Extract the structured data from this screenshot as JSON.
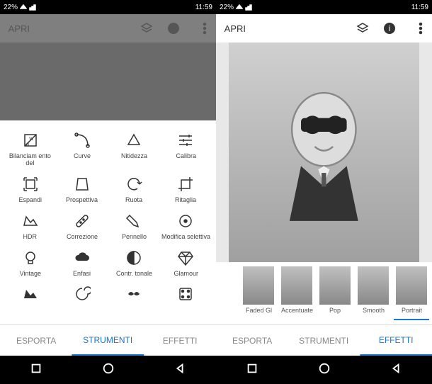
{
  "status": {
    "time": "11:59",
    "battery": "22%"
  },
  "header": {
    "open": "APRI"
  },
  "filters": [
    {
      "label": "Portrait"
    },
    {
      "label": "Smooth"
    },
    {
      "label": "Pop"
    },
    {
      "label": "Accentuate"
    },
    {
      "label": "Faded Gl"
    }
  ],
  "tabs": {
    "effects": "EFFETTI",
    "tools": "STRUMENTI",
    "export": "ESPORTA"
  },
  "tools": [
    {
      "label": "Calibra"
    },
    {
      "label": "Nitidezza"
    },
    {
      "label": "Curve"
    },
    {
      "label": "Bilanciam\nento del"
    },
    {
      "label": "Ritaglia"
    },
    {
      "label": "Ruota"
    },
    {
      "label": "Prospettiva"
    },
    {
      "label": "Espandi"
    },
    {
      "label": "Modifica\nselettiva"
    },
    {
      "label": "Pennello"
    },
    {
      "label": "Correzione"
    },
    {
      "label": "HDR"
    },
    {
      "label": "Glamour"
    },
    {
      "label": "Contr. tonale"
    },
    {
      "label": "Enfasi"
    },
    {
      "label": "Vintage"
    }
  ]
}
